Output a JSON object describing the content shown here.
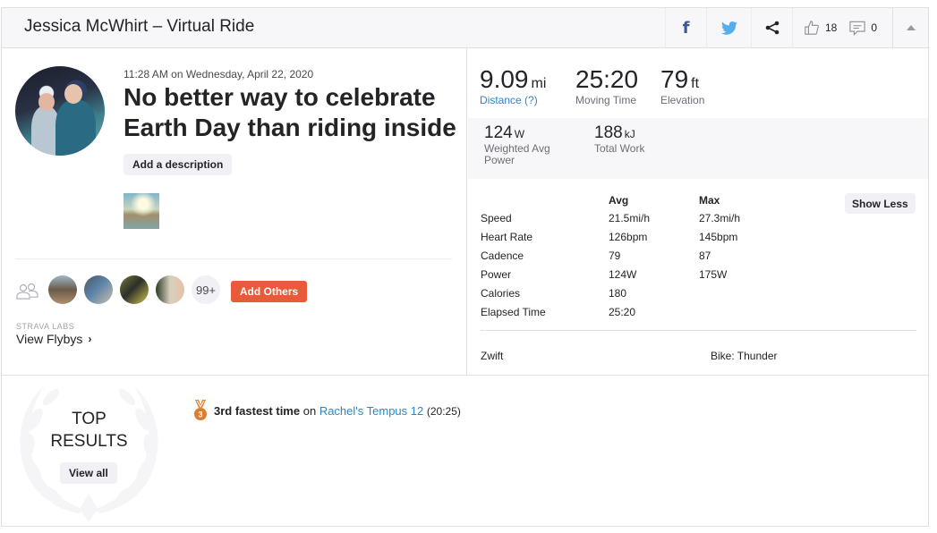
{
  "header": {
    "title": "Jessica McWhirt – Virtual Ride",
    "icons": {
      "facebook": "facebook-icon",
      "twitter": "twitter-icon",
      "share": "share-icon",
      "kudos": "thumbs-up-icon",
      "comments": "comment-icon",
      "collapse": "caret-up-icon"
    },
    "facebook_glyph": "f",
    "kudos_count": "18",
    "comments_count": "0"
  },
  "activity": {
    "timestamp": "11:28 AM on Wednesday, April 22, 2020",
    "title": "No better way to celebrate Earth Day than riding inside",
    "add_description_label": "Add a description",
    "group_more_count": "99+",
    "add_others_label": "Add Others",
    "labs_label": "STRAVA LABS",
    "flybys_label": "View Flybys",
    "flybys_chevron": "›"
  },
  "stats": {
    "primary": [
      {
        "value": "9.09",
        "unit": "mi",
        "label": "Distance (?)"
      },
      {
        "value": "25:20",
        "unit": "",
        "label": "Moving Time"
      },
      {
        "value": "79",
        "unit": "ft",
        "label": "Elevation"
      }
    ],
    "secondary": [
      {
        "value": "124",
        "unit": "W",
        "label": "Weighted Avg Power"
      },
      {
        "value": "188",
        "unit": "kJ",
        "label": "Total Work"
      }
    ],
    "table": {
      "headers": [
        "",
        "Avg",
        "Max"
      ],
      "rows": [
        [
          "Speed",
          "21.5mi/h",
          "27.3mi/h"
        ],
        [
          "Heart Rate",
          "126bpm",
          "145bpm"
        ],
        [
          "Cadence",
          "79",
          "87"
        ],
        [
          "Power",
          "124W",
          "175W"
        ],
        [
          "Calories",
          "180",
          ""
        ],
        [
          "Elapsed Time",
          "25:20",
          ""
        ]
      ]
    },
    "show_less_label": "Show Less",
    "device": "Zwift",
    "bike": "Bike: Thunder"
  },
  "results": {
    "heading_line1": "TOP",
    "heading_line2": "RESULTS",
    "view_all_label": "View all",
    "achievement": {
      "rank_badge": "3",
      "rank_text": "3rd fastest time",
      "connector": "on",
      "segment": "Rachel's Tempus 12",
      "time": "(20:25)"
    }
  },
  "colors": {
    "accent_orange": "#e95a3b",
    "link_blue": "#2a87c6",
    "facebook": "#3b5998",
    "twitter": "#55acee",
    "medal_bronze": "#e07b2a"
  }
}
